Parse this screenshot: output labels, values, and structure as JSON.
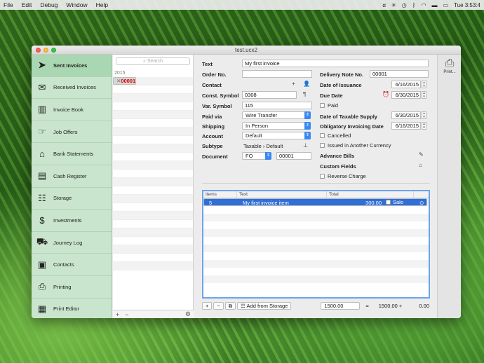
{
  "menubar": {
    "items": [
      "File",
      "Edit",
      "Debug",
      "Window",
      "Help"
    ],
    "clock": "Tue 3:53:4"
  },
  "window": {
    "title": "test.ucx2"
  },
  "sidebar": {
    "items": [
      {
        "label": "Sent Invoices",
        "icon": "send-icon"
      },
      {
        "label": "Received Invoices",
        "icon": "envelope-icon"
      },
      {
        "label": "Invoice Book",
        "icon": "books-icon"
      },
      {
        "label": "Job Offers",
        "icon": "hand-offer-icon"
      },
      {
        "label": "Bank Statements",
        "icon": "bank-icon"
      },
      {
        "label": "Cash Register",
        "icon": "cash-register-icon"
      },
      {
        "label": "Storage",
        "icon": "cabinet-icon"
      },
      {
        "label": "Investments",
        "icon": "dollar-icon"
      },
      {
        "label": "Journey Log",
        "icon": "truck-icon"
      },
      {
        "label": "Contacts",
        "icon": "contact-card-icon"
      },
      {
        "label": "Printing",
        "icon": "printer-icon"
      },
      {
        "label": "Print Editor",
        "icon": "print-editor-icon"
      }
    ]
  },
  "list": {
    "search_placeholder": "Search",
    "year": "2015",
    "rows": [
      "00001"
    ]
  },
  "form": {
    "text_label": "Text",
    "text_value": "My first invoice",
    "order_label": "Order No.",
    "order_value": "",
    "contact_label": "Contact",
    "const_label": "Const. Symbol",
    "const_value": "0308",
    "var_label": "Var. Symbol",
    "var_value": "115",
    "paidvia_label": "Paid via",
    "paidvia_value": "Wire Transfer",
    "shipping_label": "Shipping",
    "shipping_value": "In Person",
    "account_label": "Account",
    "account_value": "Default",
    "subtype_label": "Subtype",
    "subtype_value": "Taxable › Default",
    "document_label": "Document",
    "document_series": "FO",
    "document_number": "00001",
    "delivery_label": "Delivery Note No.",
    "delivery_value": "00001",
    "issuance_label": "Date of Issuance",
    "issuance_value": "6/16/2015",
    "due_label": "Due Date",
    "due_value": "6/30/2015",
    "paid_label": "Paid",
    "taxable_label": "Date of Taxable Supply",
    "taxable_value": "6/30/2015",
    "oblig_label": "Obligatory Invoicing Date",
    "oblig_value": "6/16/2015",
    "cancelled_label": "Cancelled",
    "currency_label": "Issued in Another Currency",
    "advance_label": "Advance Bills",
    "custom_label": "Custom Fields",
    "reverse_label": "Reverse Charge"
  },
  "table": {
    "headers": [
      "Items",
      "Text",
      "Total"
    ],
    "rows": [
      {
        "items": "5",
        "text": "My first invoice item",
        "total": "300.00",
        "sale_label": "Sale"
      }
    ]
  },
  "footer": {
    "add_storage": "Add from Storage",
    "amount_value": "1500.00",
    "equals": "=",
    "subtotal": "1500.00 +",
    "tax": "0.00"
  },
  "toolbar": {
    "print_label": "Print..."
  },
  "colors": {
    "sidebar_bg": "#c9e5cd",
    "sidebar_active": "#a9d7b1",
    "selection_blue": "#2e6fd8",
    "invoice_red": "#dd0000"
  }
}
